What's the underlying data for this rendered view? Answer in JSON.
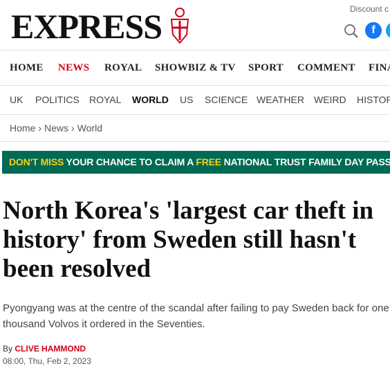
{
  "masthead": {
    "logo_text": "EXPRESS",
    "discount_text": "Discount c",
    "search_icon": "search-icon",
    "facebook_icon": "facebook-icon",
    "twitter_icon": "twitter-icon"
  },
  "nav_primary": {
    "items": [
      {
        "label": "HOME"
      },
      {
        "label": "NEWS",
        "active": true
      },
      {
        "label": "ROYAL"
      },
      {
        "label": "SHOWBIZ & TV"
      },
      {
        "label": "SPORT"
      },
      {
        "label": "COMMENT"
      },
      {
        "label": "FINA"
      }
    ]
  },
  "nav_secondary": {
    "items": [
      {
        "label": "UK"
      },
      {
        "label": "POLITICS"
      },
      {
        "label": "ROYAL"
      },
      {
        "label": "WORLD",
        "active": true
      },
      {
        "label": "US"
      },
      {
        "label": "SCIENCE"
      },
      {
        "label": "WEATHER"
      },
      {
        "label": "WEIRD"
      },
      {
        "label": "HISTOR"
      }
    ]
  },
  "breadcrumb": {
    "items": [
      "Home",
      "News",
      "World"
    ]
  },
  "banner": {
    "part1": "DON'T MISS",
    "part2": "YOUR CHANCE TO CLAIM A",
    "part3": "FREE",
    "part4": "NATIONAL TRUST FAMILY DAY PASS -"
  },
  "article": {
    "headline": "North Korea's 'largest car theft in history' from Sweden still hasn't been resolved",
    "standfirst": "Pyongyang was at the centre of the scandal after failing to pay Sweden back for one thousand Volvos it ordered in the Seventies.",
    "byline_prefix": "By",
    "author": "CLIVE HAMMOND",
    "date": "08:00, Thu, Feb 2, 2023"
  },
  "colors": {
    "brand_red": "#d0021b",
    "banner_green": "#006b55",
    "banner_yellow": "#f7d117"
  }
}
